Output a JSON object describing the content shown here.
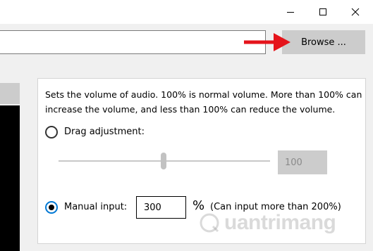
{
  "window": {
    "controls": [
      "minimize-icon",
      "maximize-icon",
      "close-icon"
    ]
  },
  "file": {
    "path_value": "",
    "browse_label": "Browse ..."
  },
  "volume": {
    "description": "Sets the volume of audio. 100% is normal volume. More than 100% can increase the volume, and less than 100% can reduce the volume.",
    "drag_label": "Drag adjustment:",
    "slider_value": "100",
    "manual_label": "Manual input:",
    "manual_value": "300",
    "percent_sign": "%",
    "manual_note": "(Can input more than 200%)",
    "selected_mode": "manual"
  },
  "annotation": {
    "arrow_color": "#e5141b"
  },
  "watermark": {
    "text": "uantrimang"
  },
  "colors": {
    "accent": "#0078d4",
    "button_bg": "#cccccc",
    "panel_bg": "#ffffff",
    "window_bg": "#f0f0f0"
  }
}
